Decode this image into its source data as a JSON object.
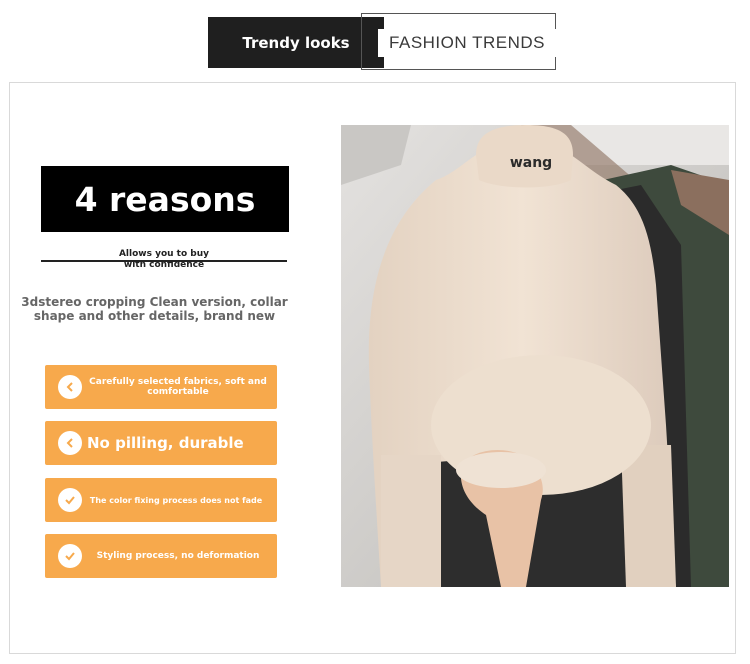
{
  "header": {
    "left_label": "Trendy looks",
    "right_label": "FASHION TRENDS"
  },
  "reasons_title": "4 reasons",
  "confidence": {
    "line1": "Allows you to buy",
    "line2": "with confidence"
  },
  "description": "3dstereo cropping Clean version, collar shape and other details, brand new",
  "features": [
    {
      "label": "Carefully selected fabrics, soft and comfortable",
      "icon": "chevron-left-icon"
    },
    {
      "label": "No pilling, durable",
      "icon": "chevron-left-icon"
    },
    {
      "label": "The color fixing process does not fade",
      "icon": "circle-check-icon"
    },
    {
      "label": "Styling process, no deformation",
      "icon": "circle-check-icon"
    }
  ],
  "photo": {
    "collar_text": "wang"
  },
  "colors": {
    "accent_orange": "#f7a94c",
    "dark": "#1f1f1f",
    "sweater": "#ecdccc"
  }
}
